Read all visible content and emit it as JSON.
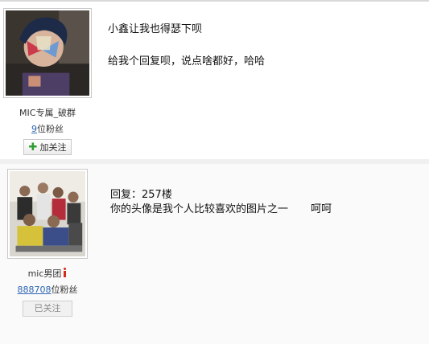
{
  "posts": [
    {
      "user": {
        "name": "MIC专属_破群",
        "fans_count": "9",
        "fans_suffix": "位粉丝"
      },
      "action": {
        "label": "加关注",
        "icon": "plus-icon"
      },
      "content": {
        "line1": "小鑫让我也得瑟下呗",
        "line2": "给我个回复呗，说点啥都好，哈哈"
      }
    },
    {
      "user": {
        "name": "mic男团",
        "fans_count": "888708",
        "fans_suffix": "位粉丝",
        "badge_icon": "info-icon"
      },
      "action": {
        "label": "已关注"
      },
      "content": {
        "line1": "回复：257楼",
        "line2_main": "你的头像是我个人比较喜欢的图片之一",
        "line2_tail": "呵呵"
      }
    }
  ],
  "colors": {
    "link_blue": "#2d64b3",
    "plus_green": "#2f9a2f",
    "badge_red": "#d42a1a"
  }
}
